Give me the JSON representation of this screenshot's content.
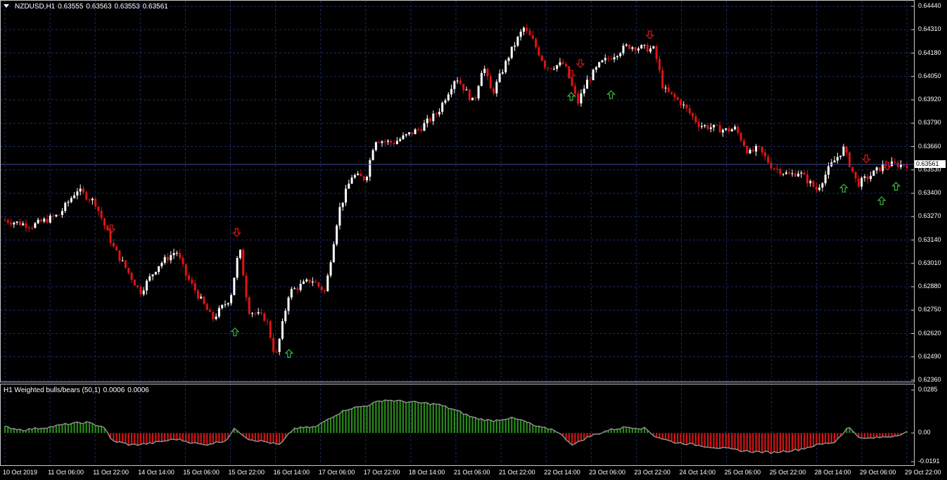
{
  "main_header": {
    "symbol": "NZDUSD,H1",
    "open": "0.63555",
    "high": "0.63563",
    "low": "0.63553",
    "close": "0.63561"
  },
  "indicator_header": {
    "name": "H1 Weighted bulls/bears (50,1)",
    "value1": "0.0006",
    "value2": "0.0006"
  },
  "current_price": "0.63561",
  "colors": {
    "background": "#000000",
    "grid": "#1a2a6e",
    "bull": "#ffffff",
    "bear": "#e01414",
    "up_arrow": "#3cb43c",
    "down_arrow": "#e01414",
    "hist_pos": "#2a8a1a",
    "hist_neg": "#d41414",
    "ind_line": "#8c8c8c"
  },
  "chart_data": [
    {
      "type": "candlestick",
      "title": "NZDUSD,H1",
      "ylim": [
        0.6236,
        0.6444
      ],
      "y_ticks": [
        "0.64440",
        "0.64310",
        "0.64180",
        "0.64050",
        "0.63920",
        "0.63790",
        "0.63660",
        "0.63530",
        "0.63400",
        "0.63270",
        "0.63140",
        "0.63010",
        "0.62880",
        "0.62750",
        "0.62620",
        "0.62490",
        "0.62360"
      ],
      "x_ticks": [
        "10 Oct 2019",
        "11 Oct 06:00",
        "11 Oct 22:00",
        "14 Oct 14:00",
        "15 Oct 06:00",
        "15 Oct 22:00",
        "16 Oct 14:00",
        "17 Oct 06:00",
        "17 Oct 22:00",
        "18 Oct 14:00",
        "21 Oct 06:00",
        "21 Oct 22:00",
        "22 Oct 14:00",
        "23 Oct 06:00",
        "23 Oct 22:00",
        "24 Oct 14:00",
        "25 Oct 06:00",
        "25 Oct 22:00",
        "28 Oct 14:00",
        "29 Oct 06:00",
        "29 Oct 22:00"
      ],
      "price_path_approx": [
        [
          0,
          0.6325
        ],
        [
          0.03,
          0.6322
        ],
        [
          0.06,
          0.6328
        ],
        [
          0.08,
          0.6342
        ],
        [
          0.1,
          0.6335
        ],
        [
          0.12,
          0.631
        ],
        [
          0.15,
          0.6285
        ],
        [
          0.17,
          0.63
        ],
        [
          0.19,
          0.6308
        ],
        [
          0.2,
          0.6295
        ],
        [
          0.23,
          0.627
        ],
        [
          0.25,
          0.6282
        ],
        [
          0.26,
          0.631
        ],
        [
          0.27,
          0.6275
        ],
        [
          0.29,
          0.627
        ],
        [
          0.3,
          0.6248
        ],
        [
          0.315,
          0.6285
        ],
        [
          0.34,
          0.6292
        ],
        [
          0.355,
          0.6285
        ],
        [
          0.37,
          0.633
        ],
        [
          0.385,
          0.635
        ],
        [
          0.4,
          0.6348
        ],
        [
          0.41,
          0.637
        ],
        [
          0.43,
          0.6368
        ],
        [
          0.46,
          0.6376
        ],
        [
          0.48,
          0.6385
        ],
        [
          0.5,
          0.6405
        ],
        [
          0.52,
          0.639
        ],
        [
          0.53,
          0.6412
        ],
        [
          0.54,
          0.6395
        ],
        [
          0.56,
          0.6418
        ],
        [
          0.575,
          0.6432
        ],
        [
          0.585,
          0.6425
        ],
        [
          0.6,
          0.641
        ],
        [
          0.62,
          0.6412
        ],
        [
          0.635,
          0.639
        ],
        [
          0.645,
          0.6402
        ],
        [
          0.66,
          0.6412
        ],
        [
          0.69,
          0.6422
        ],
        [
          0.72,
          0.642
        ],
        [
          0.73,
          0.6398
        ],
        [
          0.75,
          0.639
        ],
        [
          0.77,
          0.6378
        ],
        [
          0.8,
          0.6375
        ],
        [
          0.81,
          0.6376
        ],
        [
          0.825,
          0.6362
        ],
        [
          0.835,
          0.6365
        ],
        [
          0.85,
          0.6355
        ],
        [
          0.87,
          0.635
        ],
        [
          0.88,
          0.6352
        ],
        [
          0.9,
          0.6342
        ],
        [
          0.915,
          0.6355
        ],
        [
          0.93,
          0.6365
        ],
        [
          0.945,
          0.6345
        ],
        [
          0.96,
          0.635
        ],
        [
          0.975,
          0.6356
        ]
      ],
      "signals": [
        {
          "type": "down",
          "t": 0.118,
          "price": 0.6318
        },
        {
          "type": "down",
          "t": 0.257,
          "price": 0.6316
        },
        {
          "type": "up",
          "t": 0.255,
          "price": 0.6265
        },
        {
          "type": "up",
          "t": 0.315,
          "price": 0.6253
        },
        {
          "type": "down",
          "t": 0.628,
          "price": 0.6404
        },
        {
          "type": "down",
          "t": 0.638,
          "price": 0.641
        },
        {
          "type": "up",
          "t": 0.628,
          "price": 0.6396
        },
        {
          "type": "up",
          "t": 0.672,
          "price": 0.6397
        },
        {
          "type": "down",
          "t": 0.715,
          "price": 0.6426
        },
        {
          "type": "up",
          "t": 0.93,
          "price": 0.6345
        },
        {
          "type": "down",
          "t": 0.955,
          "price": 0.6357
        },
        {
          "type": "up",
          "t": 0.972,
          "price": 0.6338
        },
        {
          "type": "down",
          "t": 0.978,
          "price": 0.6353
        },
        {
          "type": "up",
          "t": 0.988,
          "price": 0.6346
        }
      ]
    },
    {
      "type": "histogram",
      "title": "H1 Weighted bulls/bears (50,1)",
      "ylim": [
        -0.0191,
        0.0285
      ],
      "y_ticks": [
        "0.0285",
        "0.00",
        "-0.0191"
      ],
      "profile_approx": [
        [
          0,
          0.004
        ],
        [
          0.02,
          0.002
        ],
        [
          0.05,
          0.004
        ],
        [
          0.07,
          0.006
        ],
        [
          0.09,
          0.007
        ],
        [
          0.11,
          0.004
        ],
        [
          0.118,
          -0.005
        ],
        [
          0.14,
          -0.008
        ],
        [
          0.16,
          -0.007
        ],
        [
          0.19,
          -0.004
        ],
        [
          0.22,
          -0.008
        ],
        [
          0.245,
          -0.005
        ],
        [
          0.255,
          0.003
        ],
        [
          0.27,
          -0.004
        ],
        [
          0.29,
          -0.006
        ],
        [
          0.305,
          -0.008
        ],
        [
          0.32,
          0.003
        ],
        [
          0.345,
          0.004
        ],
        [
          0.36,
          0.01
        ],
        [
          0.38,
          0.016
        ],
        [
          0.4,
          0.018
        ],
        [
          0.42,
          0.022
        ],
        [
          0.44,
          0.021
        ],
        [
          0.46,
          0.02
        ],
        [
          0.48,
          0.019
        ],
        [
          0.5,
          0.015
        ],
        [
          0.52,
          0.01
        ],
        [
          0.54,
          0.008
        ],
        [
          0.56,
          0.01
        ],
        [
          0.575,
          0.008
        ],
        [
          0.59,
          0.004
        ],
        [
          0.61,
          0.002
        ],
        [
          0.63,
          -0.008
        ],
        [
          0.645,
          -0.003
        ],
        [
          0.67,
          0.002
        ],
        [
          0.69,
          0.004
        ],
        [
          0.71,
          0.003
        ],
        [
          0.72,
          -0.002
        ],
        [
          0.74,
          -0.006
        ],
        [
          0.78,
          -0.009
        ],
        [
          0.82,
          -0.012
        ],
        [
          0.85,
          -0.013
        ],
        [
          0.88,
          -0.011
        ],
        [
          0.9,
          -0.008
        ],
        [
          0.92,
          -0.006
        ],
        [
          0.935,
          0.004
        ],
        [
          0.95,
          -0.004
        ],
        [
          0.97,
          -0.003
        ],
        [
          0.985,
          -0.002
        ],
        [
          1.0,
          0.0006
        ]
      ]
    }
  ]
}
